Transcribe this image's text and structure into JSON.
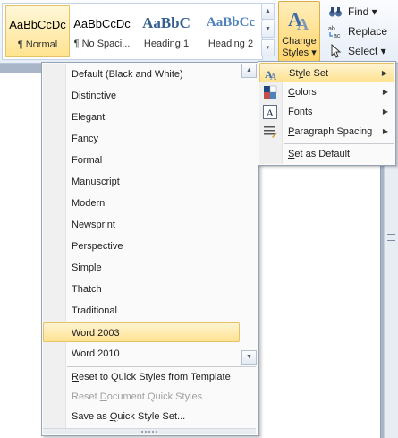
{
  "quick_styles": [
    {
      "preview": "AaBbCcDc",
      "label": "¶ Normal",
      "selected": true
    },
    {
      "preview": "AaBbCcDc",
      "label": "¶ No Spaci...",
      "selected": false
    },
    {
      "preview": "AaBbC",
      "label": "Heading 1",
      "selected": false
    },
    {
      "preview": "AaBbCc",
      "label": "Heading 2",
      "selected": false
    }
  ],
  "change_styles": {
    "line1": "Change",
    "line2": "Styles ▾"
  },
  "editing": {
    "find": "Find ▾",
    "replace": "Replace",
    "select": "Select ▾"
  },
  "style_sets": [
    "Default (Black and White)",
    "Distinctive",
    "Elegant",
    "Fancy",
    "Formal",
    "Manuscript",
    "Modern",
    "Newsprint",
    "Perspective",
    "Simple",
    "Thatch",
    "Traditional",
    "Word 2003",
    "Word 2010"
  ],
  "highlighted_style_set": "Word 2003",
  "actions": {
    "reset_template": {
      "pre": "",
      "u": "R",
      "post": "eset to Quick Styles from Template"
    },
    "reset_document": {
      "pre": "Reset ",
      "u": "D",
      "post": "ocument Quick Styles"
    },
    "save_as": {
      "pre": "Save as ",
      "u": "Q",
      "post": "uick Style Set..."
    }
  },
  "submenu": {
    "style_set": {
      "pre": "St",
      "u": "y",
      "post": "le Set"
    },
    "colors": {
      "pre": "",
      "u": "C",
      "post": "olors"
    },
    "fonts": {
      "pre": "",
      "u": "F",
      "post": "onts"
    },
    "paragraph_spacing": {
      "pre": "",
      "u": "P",
      "post": "aragraph Spacing"
    },
    "set_default": {
      "pre": "",
      "u": "S",
      "post": "et as Default"
    }
  },
  "colors": {
    "accent_highlight": "#ffe291",
    "heading_blue": "#365f91",
    "heading2_blue": "#4f81bd"
  }
}
